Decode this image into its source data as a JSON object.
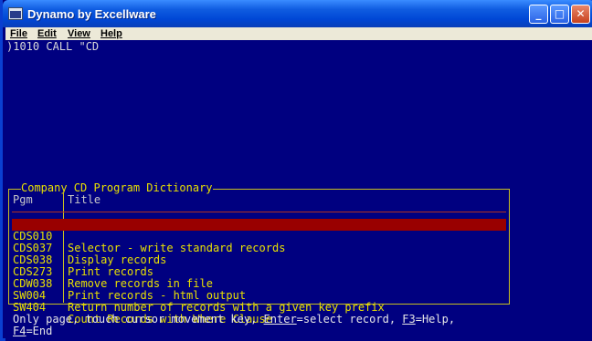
{
  "window": {
    "title": "Dynamo by Excellware",
    "minimize": "_",
    "maximize": "□",
    "close": "✕"
  },
  "menu": [
    "File",
    "Edit",
    "View",
    "Help"
  ],
  "console": {
    "line1": ")1010 CALL \"CD"
  },
  "dictionary": {
    "title": "Company CD Program Dictionary",
    "col_pgm": "Pgm",
    "col_title": "Title",
    "rows": [
      {
        "pgm": "CDS010",
        "title": "Selector - write standard records",
        "selected": true
      },
      {
        "pgm": "CDS037",
        "title": "Display records"
      },
      {
        "pgm": "CDS038",
        "title": "Print records"
      },
      {
        "pgm": "CDS273",
        "title": "Remove records in file"
      },
      {
        "pgm": "CDW038",
        "title": "Print records - html output"
      },
      {
        "pgm": "SW004",
        "title": "Return number of records with a given key prefix"
      },
      {
        "pgm": "SW404",
        "title": "Count Records with Where Clause"
      }
    ]
  },
  "footer": {
    "prefix": "Only page, touch cursor movement key, ",
    "enter_key": "Enter",
    "enter_text": "=select record, ",
    "f3_key": "F3",
    "f3_text": "=Help,",
    "f4_key": "F4",
    "f4_text": "=End"
  },
  "colors": {
    "screen_bg": "#000080",
    "selection_bg": "#990000",
    "list_text": "#e8e000"
  }
}
